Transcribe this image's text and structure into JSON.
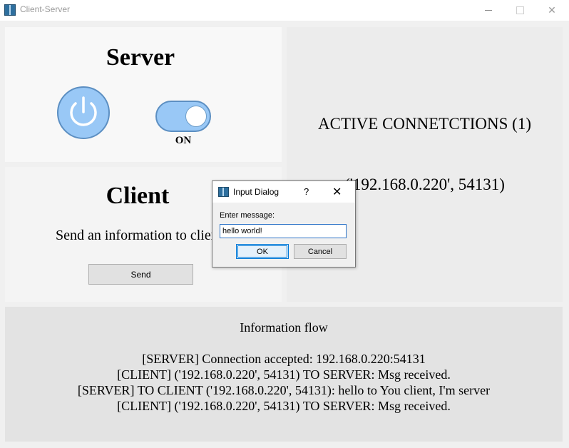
{
  "window": {
    "title": "Client-Server",
    "icon": "app-window-icon",
    "controls": [
      "minimize",
      "maximize",
      "close"
    ]
  },
  "server": {
    "heading": "Server",
    "power_icon": "power-icon",
    "toggle_state": "ON"
  },
  "client": {
    "heading": "Client",
    "description": "Send an information to client",
    "send_label": "Send"
  },
  "connections": {
    "heading": "ACTIVE CONNETCTIONS (1)",
    "items": [
      "('192.168.0.220', 54131)"
    ]
  },
  "flow": {
    "heading": "Information flow",
    "lines": [
      "[SERVER] Connection accepted: 192.168.0.220:54131",
      "[CLIENT] ('192.168.0.220', 54131) TO SERVER: Msg received.",
      "[SERVER] TO CLIENT ('192.168.0.220', 54131): hello to You client, I'm server",
      "[CLIENT] ('192.168.0.220', 54131) TO SERVER: Msg received."
    ]
  },
  "dialog": {
    "title": "Input Dialog",
    "help": "?",
    "prompt": "Enter message:",
    "input_value": "hello world!",
    "ok_label": "OK",
    "cancel_label": "Cancel"
  },
  "colors": {
    "accent_fill": "#99c8f6",
    "accent_border": "#5c8fc2",
    "focus_blue": "#0078d7"
  }
}
